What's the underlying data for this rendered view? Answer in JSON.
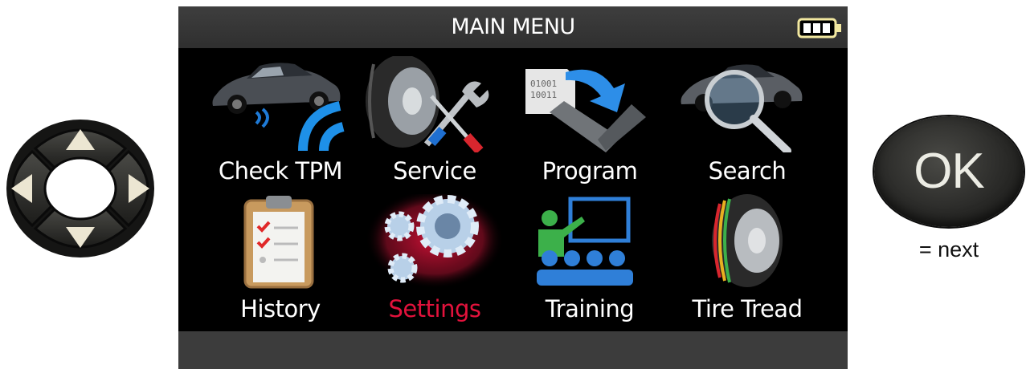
{
  "screen": {
    "title": "MAIN MENU",
    "battery_icon": "battery-full-icon",
    "selected_item": "Settings",
    "selected_color": "#e3123c",
    "menu_items": [
      {
        "label": "Check  TPM",
        "icon": "car-tpms-signal-icon"
      },
      {
        "label": "Service",
        "icon": "tire-tools-icon"
      },
      {
        "label": "Program",
        "icon": "sensor-program-icon"
      },
      {
        "label": "Search",
        "icon": "car-magnifier-icon"
      },
      {
        "label": "History",
        "icon": "clipboard-checklist-icon"
      },
      {
        "label": "Settings",
        "icon": "gears-icon"
      },
      {
        "label": "Training",
        "icon": "classroom-icon"
      },
      {
        "label": "Tire Tread",
        "icon": "tire-tread-icon"
      }
    ]
  },
  "controls": {
    "dpad_icon": "directional-pad-icon",
    "ok_label": "OK",
    "ok_caption": "= next"
  }
}
